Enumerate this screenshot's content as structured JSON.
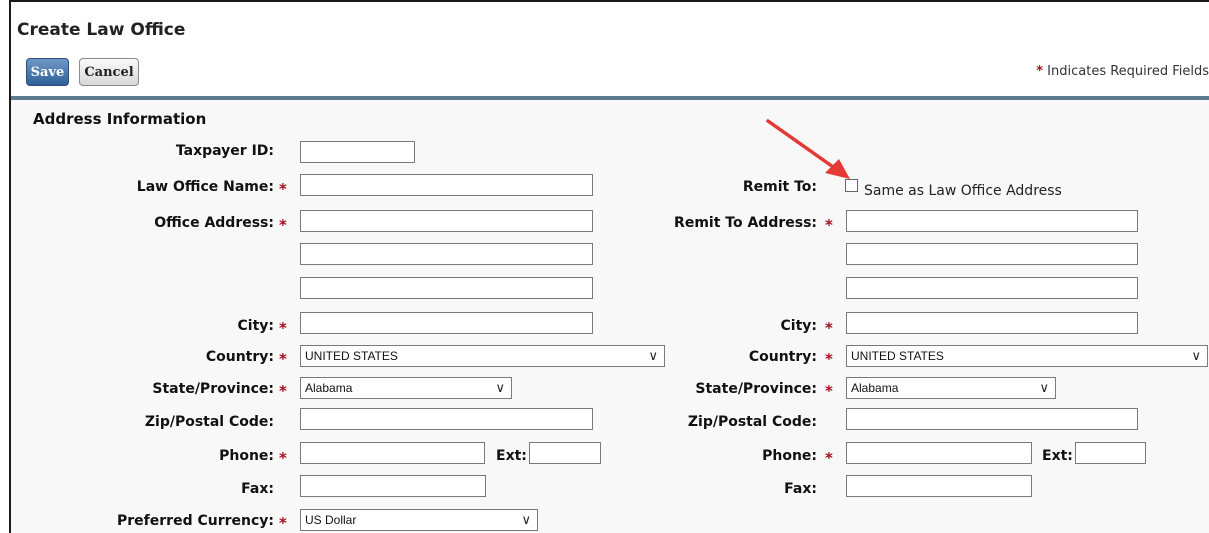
{
  "page": {
    "title": "Create Law Office",
    "save_label": "Save",
    "cancel_label": "Cancel",
    "required_star": "*",
    "required_note": "Indicates Required Fields"
  },
  "section": {
    "title": "Address Information"
  },
  "left": {
    "taxpayer_id": {
      "label": "Taxpayer ID:",
      "value": ""
    },
    "law_office_name": {
      "label": "Law Office Name:",
      "value": ""
    },
    "office_address": {
      "label": "Office Address:",
      "line1": "",
      "line2": "",
      "line3": ""
    },
    "city": {
      "label": "City:",
      "value": ""
    },
    "country": {
      "label": "Country:",
      "selected": "UNITED STATES"
    },
    "state": {
      "label": "State/Province:",
      "selected": "Alabama"
    },
    "zip": {
      "label": "Zip/Postal Code:",
      "value": ""
    },
    "phone": {
      "label": "Phone:",
      "value": "",
      "ext_label": "Ext:",
      "ext_value": ""
    },
    "fax": {
      "label": "Fax:",
      "value": ""
    },
    "currency": {
      "label": "Preferred Currency:",
      "selected": "US Dollar"
    }
  },
  "right": {
    "remit_to": {
      "label": "Remit To:",
      "checkbox_label": "Same as Law Office Address",
      "checked": false
    },
    "remit_address": {
      "label": "Remit To Address:",
      "line1": "",
      "line2": "",
      "line3": ""
    },
    "city": {
      "label": "City:",
      "value": ""
    },
    "country": {
      "label": "Country:",
      "selected": "UNITED STATES"
    },
    "state": {
      "label": "State/Province:",
      "selected": "Alabama"
    },
    "zip": {
      "label": "Zip/Postal Code:",
      "value": ""
    },
    "phone": {
      "label": "Phone:",
      "value": "",
      "ext_label": "Ext:",
      "ext_value": ""
    },
    "fax": {
      "label": "Fax:",
      "value": ""
    }
  },
  "annotation": {
    "arrow_color": "#e53935"
  }
}
